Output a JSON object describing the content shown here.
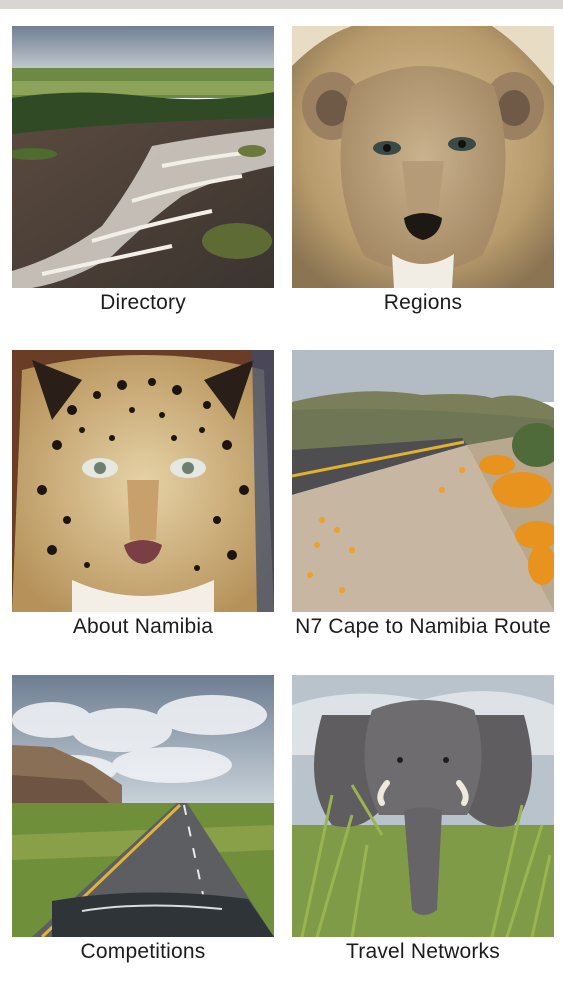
{
  "tiles": [
    {
      "label": "Directory",
      "image": "aerial river rapids landscape"
    },
    {
      "label": "Regions",
      "image": "lion face close-up"
    },
    {
      "label": "About Namibia",
      "image": "leopard face close-up"
    },
    {
      "label": "N7 Cape to Namibia Route",
      "image": "roadside with orange wildflowers"
    },
    {
      "label": "Competitions",
      "image": "straight road under cloudy sky"
    },
    {
      "label": "Travel Networks",
      "image": "elephant in tall grass"
    }
  ]
}
